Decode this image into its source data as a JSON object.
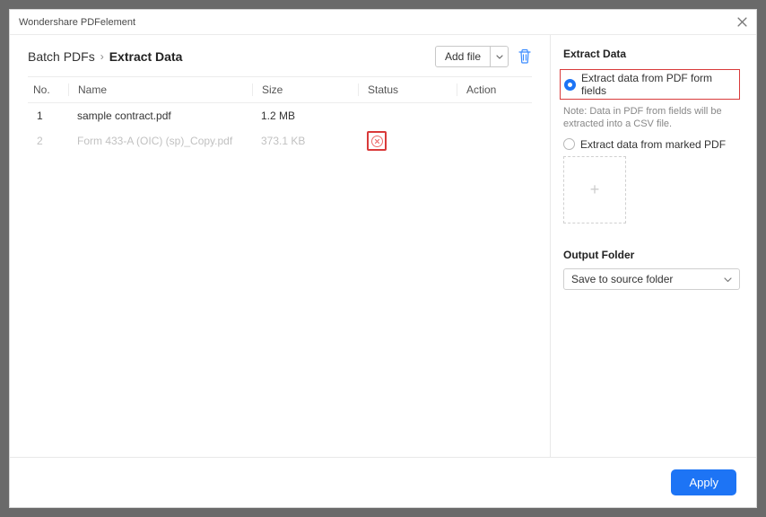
{
  "window": {
    "title": "Wondershare PDFelement"
  },
  "breadcrumbs": {
    "root": "Batch PDFs",
    "current": "Extract Data"
  },
  "toolbar": {
    "add_file": "Add file"
  },
  "table": {
    "headers": {
      "no": "No.",
      "name": "Name",
      "size": "Size",
      "status": "Status",
      "action": "Action"
    },
    "rows": [
      {
        "no": "1",
        "name": "sample contract.pdf",
        "size": "1.2 MB",
        "dim": false,
        "delete": false
      },
      {
        "no": "2",
        "name": "Form 433-A (OIC) (sp)_Copy.pdf",
        "size": "373.1 KB",
        "dim": true,
        "delete": true
      }
    ]
  },
  "side": {
    "title": "Extract Data",
    "opt1": "Extract data from PDF form fields",
    "note": "Note: Data in PDF from fields will be extracted into a CSV file.",
    "opt2": "Extract data from marked PDF",
    "output_label": "Output Folder",
    "output_value": "Save to source folder"
  },
  "footer": {
    "apply": "Apply"
  }
}
